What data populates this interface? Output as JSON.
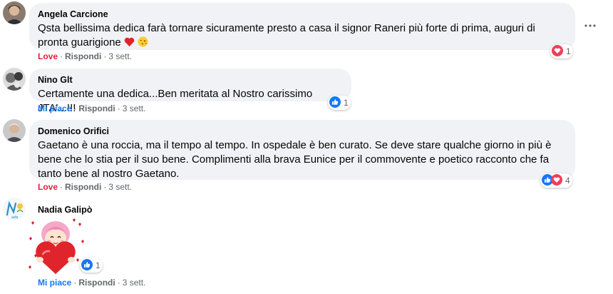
{
  "comments": [
    {
      "author": "Angela Carcione",
      "text": "Qsta bellissima dedica farà tornare sicuramente presto a casa il signor Raneri più forte di prima, auguri di pronta guarigione",
      "like_label": "Love",
      "reply_label": "Rispondi",
      "time": "3 sett.",
      "reaction_count": "1"
    },
    {
      "author": "Nino Glt",
      "text": "Certamente una dedica...Ben meritata al Nostro carissimo JTA'...!!!",
      "like_label": "Mi piace",
      "reply_label": "Rispondi",
      "time": "3 sett.",
      "reaction_count": "1"
    },
    {
      "author": "Domenico Orifici",
      "text": "Gaetano è una roccia, ma il tempo al tempo. In ospedale è ben curato. Se deve stare qualche giorno in più è bene che lo stia per il suo bene. Complimenti alla brava Eunice per il commovente e poetico racconto che fa tanto bene al nostro Gaetano.",
      "like_label": "Love",
      "reply_label": "Rispondi",
      "time": "3 sett.",
      "reaction_count": "4"
    },
    {
      "author": "Nadia Galipò",
      "like_label": "Mi piace",
      "reply_label": "Rispondi",
      "time": "3 sett.",
      "reaction_count": "1"
    }
  ],
  "colors": {
    "bubble": "#f0f2f5",
    "love": "#e41e3f",
    "like": "#1877f2",
    "meta": "#65676b"
  },
  "icons": [
    "more-options-icon",
    "love-reaction-icon",
    "like-reaction-icon",
    "heart-emoji-icon",
    "kiss-emoji-icon"
  ]
}
